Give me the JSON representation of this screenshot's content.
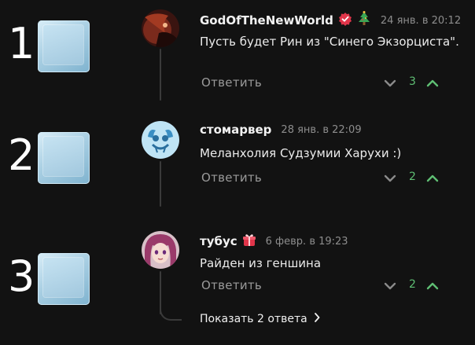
{
  "markers": [
    {
      "number": "1"
    },
    {
      "number": "2"
    },
    {
      "number": "3"
    }
  ],
  "comments": [
    {
      "username": "GodOfTheNewWorld",
      "date": "24 янв. в 20:12",
      "text": "Пусть будет Рин из \"Синего Экзорциста\".",
      "reply_label": "Ответить",
      "score": "3",
      "badges": [
        "verified-badge-icon",
        "christmas-tree-icon"
      ]
    },
    {
      "username": "стомарвер",
      "date": "28 янв. в 22:09",
      "text": "Меланхолия Судзумии Харухи :)",
      "reply_label": "Ответить",
      "score": "2",
      "badges": []
    },
    {
      "username": "тубус",
      "date": "6 февр. в 19:23",
      "text": "Райден из геншина",
      "reply_label": "Ответить",
      "score": "2",
      "badges": [
        "gift-badge-icon"
      ]
    }
  ],
  "show_replies_label": "Показать 2 ответа",
  "colors": {
    "background": "#121212",
    "score_green": "#5fbf74",
    "muted": "#8d8d8d",
    "thread_line": "#3a3a3a"
  }
}
